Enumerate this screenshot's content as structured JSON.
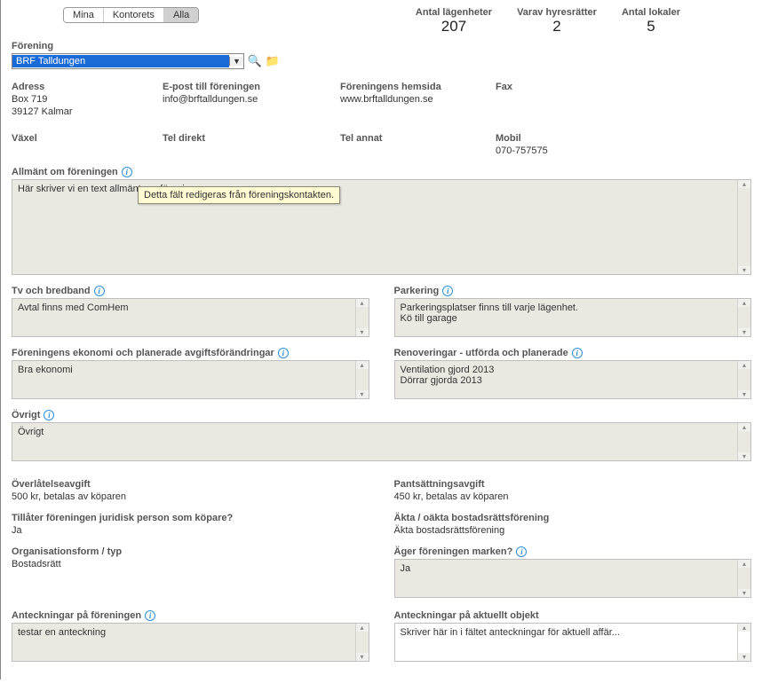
{
  "tabs": {
    "mina": "Mina",
    "kontorets": "Kontorets",
    "alla": "Alla",
    "active": "alla"
  },
  "stats": {
    "apartments": {
      "label": "Antal lägenheter",
      "value": "207"
    },
    "rentals": {
      "label": "Varav hyresrätter",
      "value": "2"
    },
    "premises": {
      "label": "Antal lokaler",
      "value": "5"
    }
  },
  "association": {
    "label": "Förening",
    "selected": "BRF Talldungen"
  },
  "contact": {
    "address": {
      "label": "Adress",
      "line1": "Box 719",
      "line2": "39127 Kalmar"
    },
    "email": {
      "label": "E-post till föreningen",
      "value": "info@brftalldungen.se"
    },
    "website": {
      "label": "Föreningens hemsida",
      "value": "www.brftalldungen.se"
    },
    "fax": {
      "label": "Fax",
      "value": ""
    },
    "switchboard": {
      "label": "Växel",
      "value": ""
    },
    "direct": {
      "label": "Tel direkt",
      "value": ""
    },
    "other": {
      "label": "Tel annat",
      "value": ""
    },
    "mobile": {
      "label": "Mobil",
      "value": "070-757575"
    }
  },
  "general": {
    "label": "Allmänt om föreningen",
    "text": "Här skriver vi en text allmänt om föreningen",
    "tooltip": "Detta fält redigeras från föreningskontakten."
  },
  "tv": {
    "label": "Tv och bredband",
    "text": "Avtal finns med ComHem"
  },
  "parking": {
    "label": "Parkering",
    "line1": "Parkeringsplatser finns till varje lägenhet.",
    "line2": "Kö till garage"
  },
  "economy": {
    "label": "Föreningens ekonomi och planerade avgiftsförändringar",
    "text": "Bra ekonomi"
  },
  "renov": {
    "label": "Renoveringar - utförda och planerade",
    "line1": "Ventilation gjord 2013",
    "line2": "Dörrar gjorda 2013"
  },
  "misc": {
    "label": "Övrigt",
    "text": "Övrigt"
  },
  "transfer_fee": {
    "label": "Överlåtelseavgift",
    "value": "500 kr, betalas av köparen"
  },
  "pledge_fee": {
    "label": "Pantsättningsavgift",
    "value": "450 kr, betalas av köparen"
  },
  "legal_buyer": {
    "label": "Tillåter föreningen juridisk person som köpare?",
    "value": "Ja"
  },
  "genuine": {
    "label": "Äkta / oäkta bostadsrättsförening",
    "value": "Äkta bostadsrättsförening"
  },
  "org_form": {
    "label": "Organisationsform / typ",
    "value": "Bostadsrätt"
  },
  "owns_land": {
    "label": "Äger föreningen marken?",
    "text": "Ja"
  },
  "notes_assoc": {
    "label": "Anteckningar på föreningen",
    "text": "testar en anteckning"
  },
  "notes_object": {
    "label": "Anteckningar på aktuellt objekt",
    "text": "Skriver här in i fältet anteckningar för aktuell affär..."
  }
}
